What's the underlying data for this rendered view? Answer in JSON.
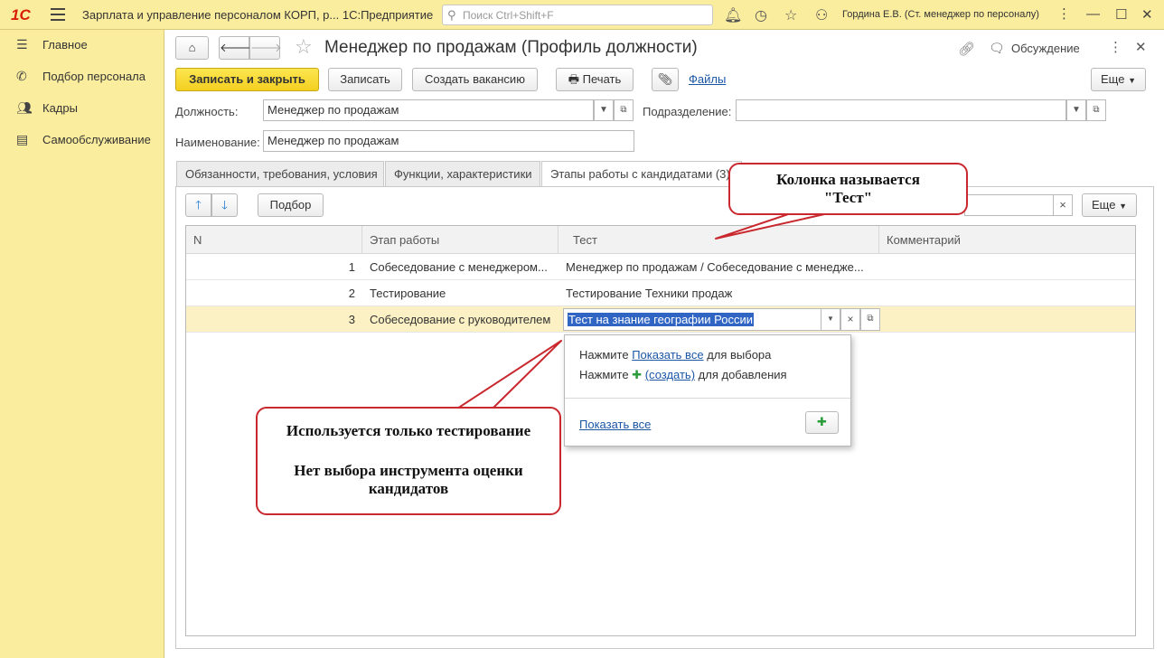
{
  "titlebar": {
    "logo": "1С",
    "app_title": "Зарплата и управление персоналом КОРП, р... 1С:Предприятие",
    "search_placeholder": "Поиск Ctrl+Shift+F",
    "user": "Гордина Е.В. (Ст. менеджер по персоналу)"
  },
  "sidebar": {
    "items": [
      {
        "label": "Главное",
        "icon": "menu-icon"
      },
      {
        "label": "Подбор персонала",
        "icon": "phone-icon"
      },
      {
        "label": "Кадры",
        "icon": "people-icon"
      },
      {
        "label": "Самообслуживание",
        "icon": "card-icon"
      }
    ]
  },
  "form": {
    "title": "Менеджер по продажам (Профиль должности)",
    "discussion": "Обсуждение",
    "toolbar": {
      "save_close": "Записать и закрыть",
      "save": "Записать",
      "create_vacancy": "Создать вакансию",
      "print": "Печать",
      "files": "Файлы",
      "more": "Еще"
    },
    "fields": {
      "position_label": "Должность:",
      "position_value": "Менеджер по продажам",
      "department_label": "Подразделение:",
      "department_value": "",
      "name_label": "Наименование:",
      "name_value": "Менеджер по продажам"
    },
    "tabs": [
      {
        "label": "Обязанности, требования, условия"
      },
      {
        "label": "Функции, характеристики"
      },
      {
        "label": "Этапы работы с кандидатами (3)"
      }
    ],
    "panel": {
      "pick_button": "Подбор",
      "more": "Еще",
      "clear": "×"
    },
    "table": {
      "columns": [
        "N",
        "Этап работы",
        "Тест",
        "Комментарий"
      ],
      "rows": [
        {
          "n": "1",
          "stage": "Собеседование с менеджером...",
          "test": "Менеджер по продажам / Собеседование с менедже...",
          "comment": ""
        },
        {
          "n": "2",
          "stage": "Тестирование",
          "test": "Тестирование Техники продаж",
          "comment": ""
        },
        {
          "n": "3",
          "stage": "Собеседование с руководителем",
          "test": "Тест на знание географии России",
          "comment": ""
        }
      ]
    },
    "dropdown": {
      "press1": "Нажмите",
      "show_all_link": "Показать все",
      "for_select": "для выбора",
      "press2": "Нажмите",
      "create_link": "(создать)",
      "for_add": "для добавления",
      "show_all_bottom": "Показать все"
    }
  },
  "callouts": {
    "top_line1": "Колонка называется",
    "top_line2": "\"Тест\"",
    "bottom_line1": "Используется только тестирование",
    "bottom_line2": "Нет выбора инструмента оценки",
    "bottom_line3": "кандидатов"
  },
  "colors": {
    "titlebar_bg": "#fbed9e",
    "primary_button": "#f3cf20",
    "selected_row": "#fbf1c4",
    "callout_border": "#c8282e",
    "link": "#1b56a5"
  }
}
